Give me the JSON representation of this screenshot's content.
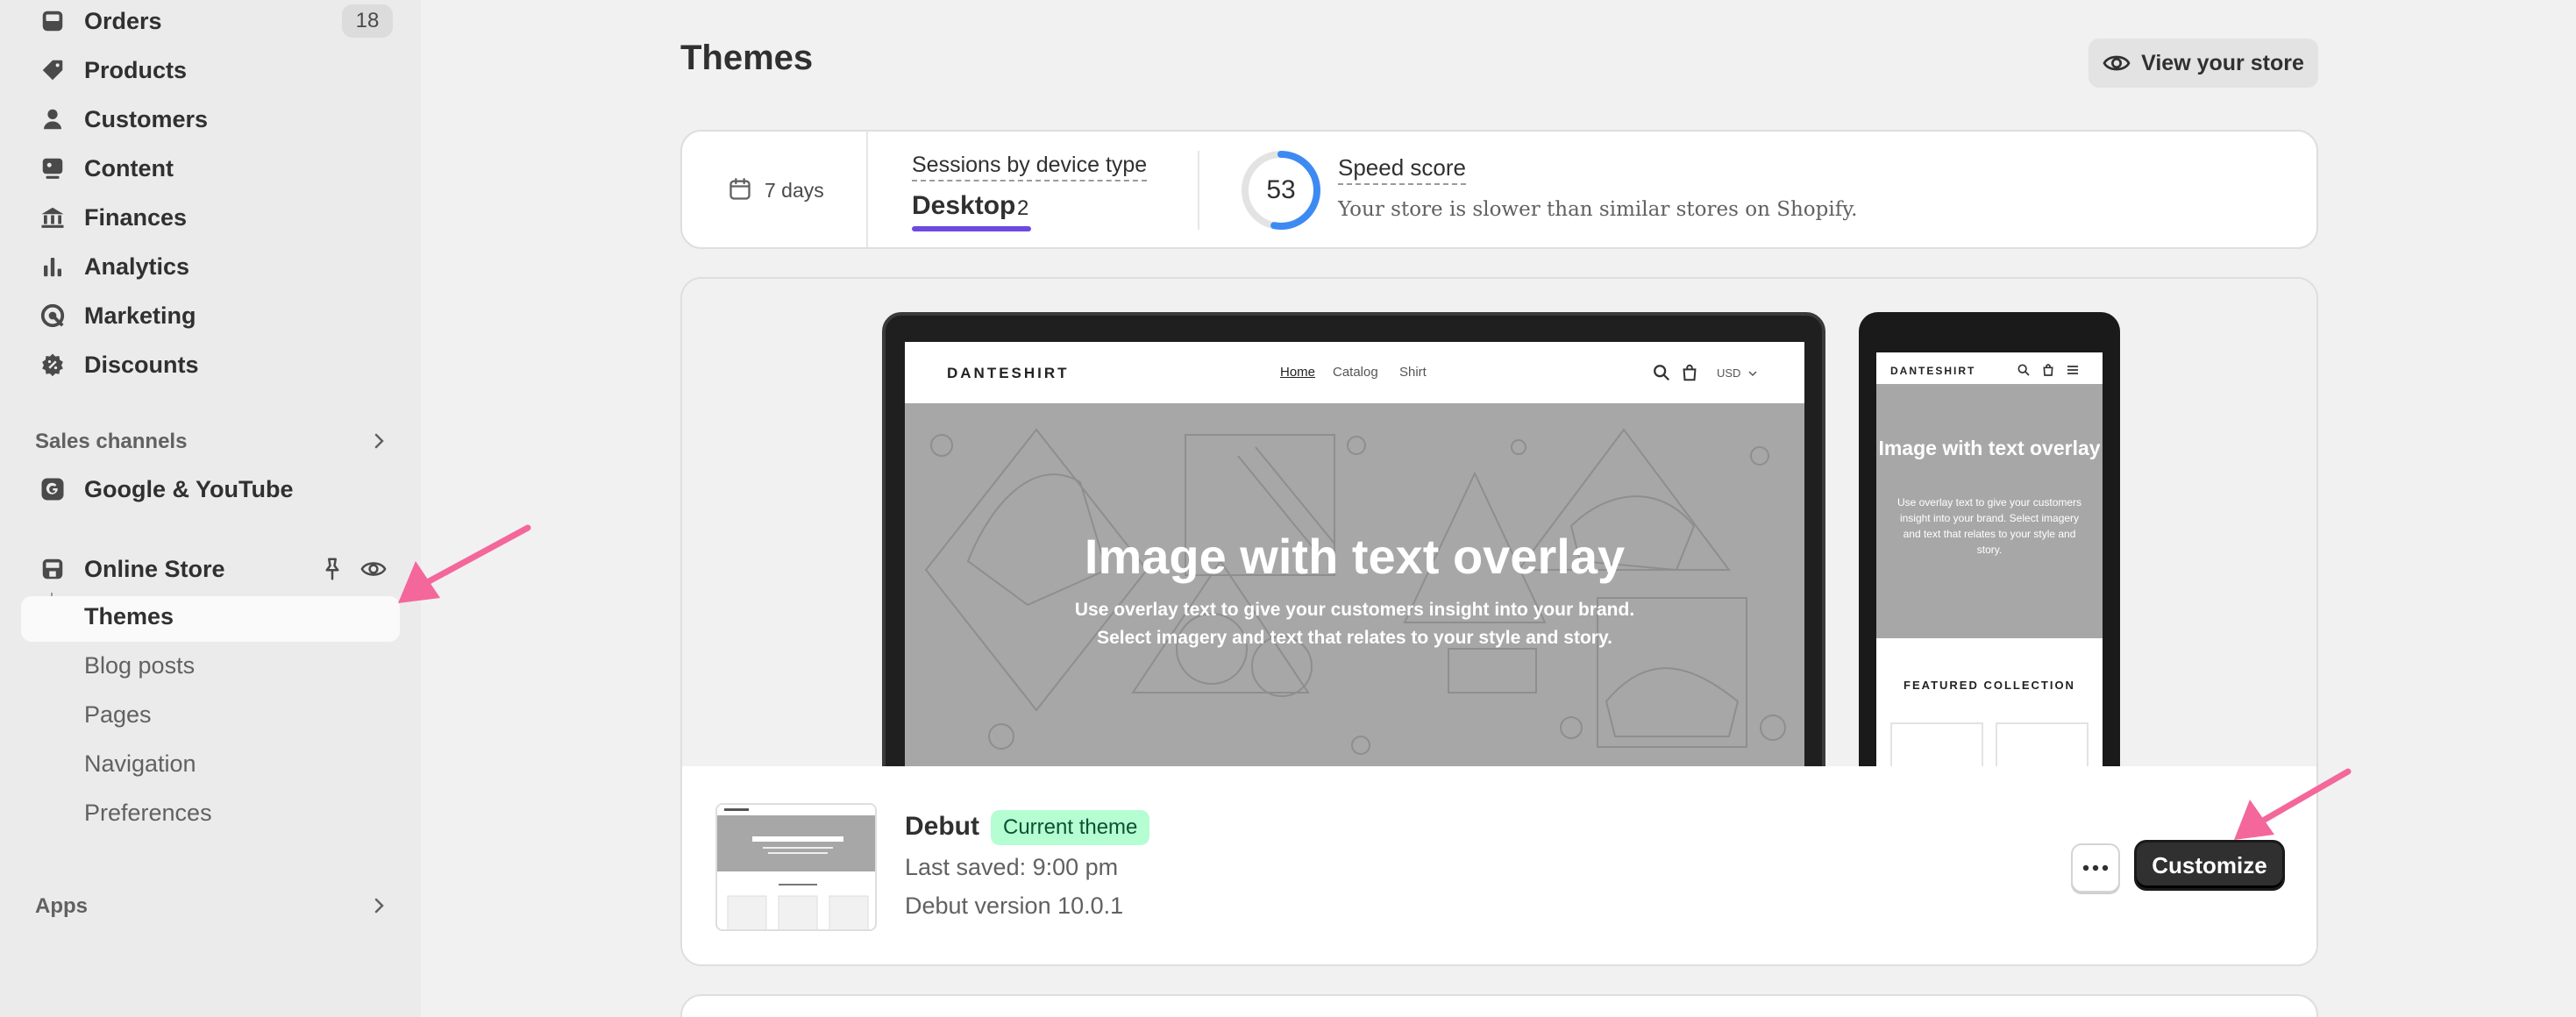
{
  "sidebar": {
    "items": [
      {
        "label": "Orders",
        "badge": "18",
        "icon": "orders-icon"
      },
      {
        "label": "Products",
        "icon": "tag-icon"
      },
      {
        "label": "Customers",
        "icon": "person-icon"
      },
      {
        "label": "Content",
        "icon": "content-icon"
      },
      {
        "label": "Finances",
        "icon": "bank-icon"
      },
      {
        "label": "Analytics",
        "icon": "bar-chart-icon"
      },
      {
        "label": "Marketing",
        "icon": "target-icon"
      },
      {
        "label": "Discounts",
        "icon": "discount-icon"
      }
    ],
    "sales_channels_title": "Sales channels",
    "google_label": "Google & YouTube",
    "online_store_label": "Online Store",
    "sub_items": [
      "Themes",
      "Blog posts",
      "Pages",
      "Navigation",
      "Preferences"
    ],
    "apps_title": "Apps"
  },
  "header": {
    "title": "Themes",
    "view_store_label": "View your store"
  },
  "stats": {
    "days": "7 days",
    "sessions_label": "Sessions by device type",
    "device": "Desktop",
    "device_count": "2",
    "speed_score": "53",
    "speed_score_value": 53,
    "speed_label": "Speed score",
    "speed_desc": "Your store is slower than similar stores on Shopify."
  },
  "preview": {
    "brand": "DANTESHIRT",
    "nav": [
      "Home",
      "Catalog",
      "Shirt"
    ],
    "currency": "USD",
    "hero_title": "Image with text overlay",
    "hero_sub_line1": "Use overlay text to give your customers insight into your brand.",
    "hero_sub_line2": "Select imagery and text that relates to your style and story.",
    "phone_hero_title": "Image with text overlay",
    "phone_hero_sub": "Use overlay text to give your customers insight into your brand. Select imagery and text that relates to your style and story.",
    "featured": "FEATURED COLLECTION"
  },
  "theme": {
    "name": "Debut",
    "badge": "Current theme",
    "last_saved": "Last saved: 9:00 pm",
    "version": "Debut version 10.0.1",
    "customize_label": "Customize"
  },
  "colors": {
    "accent": "#6c4ae0",
    "badge_bg": "#b4fed2",
    "arrow": "#f4679b",
    "ring": "#3d8bf2"
  }
}
